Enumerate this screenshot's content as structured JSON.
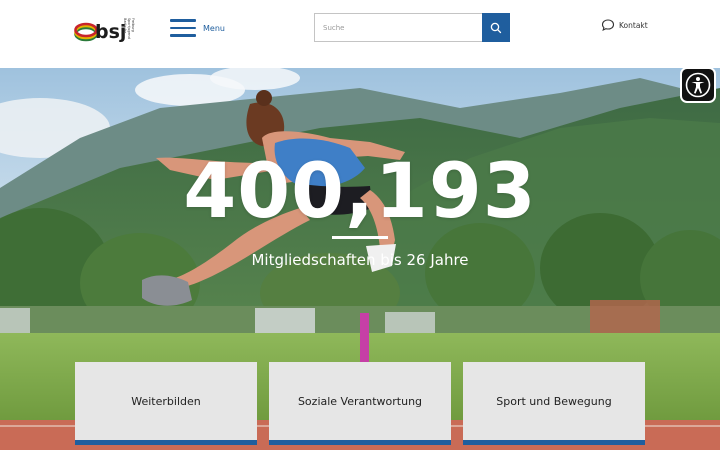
{
  "header": {
    "logo_text": "bsj",
    "logo_subtext": "Badische Sportjugend Freiburg",
    "menu_label": "Menu",
    "search_placeholder": "Suche",
    "contact_label": "Kontakt"
  },
  "hero": {
    "stat_value": "400,193",
    "stat_caption": "Mitgliedschaften bis 26 Jahre"
  },
  "cards": [
    {
      "label": "Weiterbilden"
    },
    {
      "label": "Soziale Verantwortung"
    },
    {
      "label": "Sport und Bewegung"
    }
  ],
  "colors": {
    "brand_blue": "#1f5e9e",
    "card_bg": "#e6e6e6"
  },
  "icons": {
    "search": "magnifier-icon",
    "contact": "chat-bubble-icon",
    "accessibility": "accessibility-person-icon",
    "menu": "hamburger-icon"
  }
}
